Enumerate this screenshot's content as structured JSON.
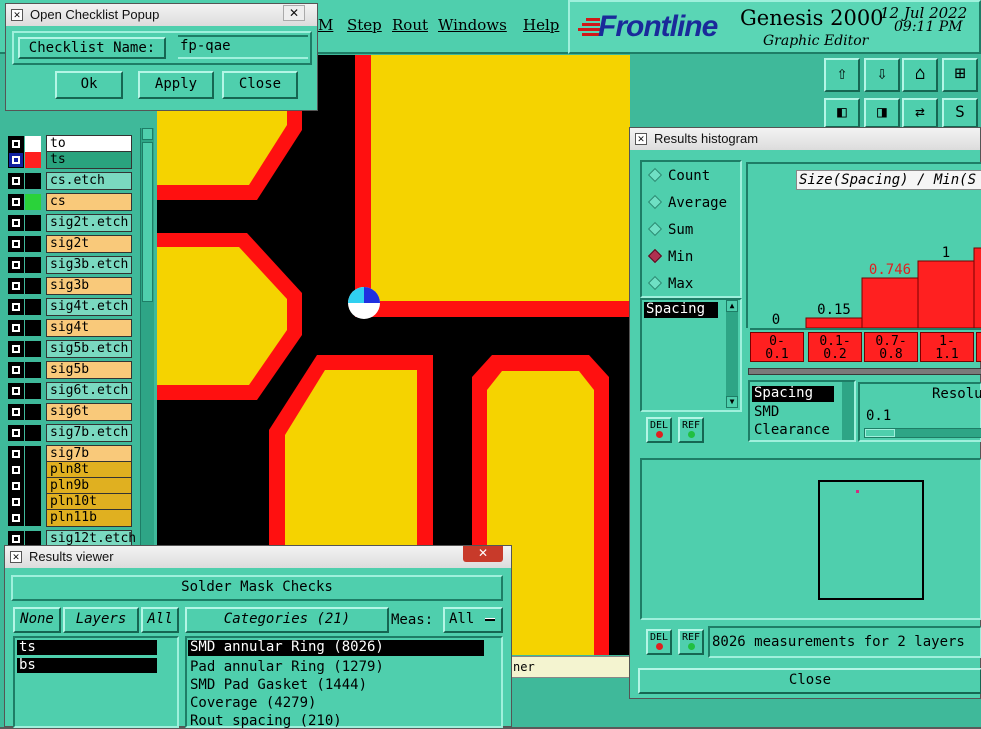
{
  "main_window": {
    "menu": [
      "M",
      "Step",
      "Rout",
      "Windows",
      "Help"
    ],
    "brand": "Frontline",
    "product": "Genesis 2000",
    "subtitle": "Graphic Editor",
    "date": "12 Jul 2022",
    "time": "09:11 PM",
    "layers": [
      {
        "name": "to",
        "color": "#ffffff",
        "bg": "#ffffff",
        "suffix": "⬥"
      },
      {
        "name": "ts",
        "color": "#ff2020",
        "bg": "#2aa37e",
        "suffix": "⬥⊕",
        "sel": true
      },
      {
        "name": "cs.etch",
        "color": "#000000",
        "bg": "#7ad9c0"
      },
      {
        "name": "cs",
        "color": "#2ad23a",
        "bg": "#f9c97a"
      },
      {
        "name": "sig2t.etch",
        "color": "#000000",
        "bg": "#7ad9c0"
      },
      {
        "name": "sig2t",
        "color": "#000000",
        "bg": "#f9c97a"
      },
      {
        "name": "sig3b.etch",
        "color": "#000000",
        "bg": "#7ad9c0"
      },
      {
        "name": "sig3b",
        "color": "#000000",
        "bg": "#f9c97a"
      },
      {
        "name": "sig4t.etch",
        "color": "#000000",
        "bg": "#7ad9c0"
      },
      {
        "name": "sig4t",
        "color": "#000000",
        "bg": "#f9c97a"
      },
      {
        "name": "sig5b.etch",
        "color": "#000000",
        "bg": "#7ad9c0"
      },
      {
        "name": "sig5b",
        "color": "#000000",
        "bg": "#f9c97a"
      },
      {
        "name": "sig6t.etch",
        "color": "#000000",
        "bg": "#7ad9c0"
      },
      {
        "name": "sig6t",
        "color": "#000000",
        "bg": "#f9c97a"
      },
      {
        "name": "sig7b.etch",
        "color": "#000000",
        "bg": "#7ad9c0"
      },
      {
        "name": "sig7b",
        "color": "#000000",
        "bg": "#f9c97a"
      },
      {
        "name": "pln8t",
        "color": "#000000",
        "bg": "#e0b020"
      },
      {
        "name": "pln9b",
        "color": "#000000",
        "bg": "#e0b020"
      },
      {
        "name": "pln10t",
        "color": "#000000",
        "bg": "#e0b020"
      },
      {
        "name": "pln11b",
        "color": "#000000",
        "bg": "#e0b020"
      },
      {
        "name": "sig12t.etch",
        "color": "#000000",
        "bg": "#7ad9c0"
      }
    ],
    "status_fragment": "ner"
  },
  "checklist_popup": {
    "title": "Open Checklist Popup",
    "label": "Checklist Name:",
    "value": "fp-qae",
    "ok": "Ok",
    "apply": "Apply",
    "close": "Close"
  },
  "results_viewer": {
    "title": "Results viewer",
    "header": "Solder Mask Checks",
    "none": "None",
    "layers": "Layers",
    "all": "All",
    "categories": "Categories (21)",
    "meas_label": "Meas:",
    "meas_value": "All",
    "layer_items": [
      "ts",
      "bs"
    ],
    "category_items": [
      "SMD annular Ring (8026)",
      "Pad annular Ring (1279)",
      "SMD Pad Gasket (1444)",
      "Coverage (4279)",
      "Rout spacing (210)"
    ]
  },
  "histogram": {
    "title": "Results histogram",
    "modes": [
      "Count",
      "Average",
      "Sum",
      "Min",
      "Max"
    ],
    "selected_mode": "Min",
    "list_top": "Spacing",
    "chart_title": "Size(Spacing) / Min(S",
    "del": "DEL",
    "ref": "REF",
    "bars": [
      {
        "value": 0,
        "label": "0",
        "range": [
          "0-",
          "0.1"
        ]
      },
      {
        "value": 0.15,
        "label": "0.15",
        "range": [
          "0.1-",
          "0.2"
        ]
      },
      {
        "value": 0.746,
        "label": "0.746",
        "range": [
          "0.7-",
          "0.8"
        ]
      },
      {
        "value": 1,
        "label": "1",
        "range": [
          "1-",
          "1.1"
        ]
      },
      {
        "value": 1.2,
        "label": "",
        "range": [
          "",
          ""
        ]
      }
    ],
    "measure_list": [
      "Spacing",
      "SMD",
      "Clearance"
    ],
    "resolution_label": "Resolu",
    "resolution_value": "0.1",
    "summary": "8026 measurements for 2 layers",
    "close": "Close"
  }
}
